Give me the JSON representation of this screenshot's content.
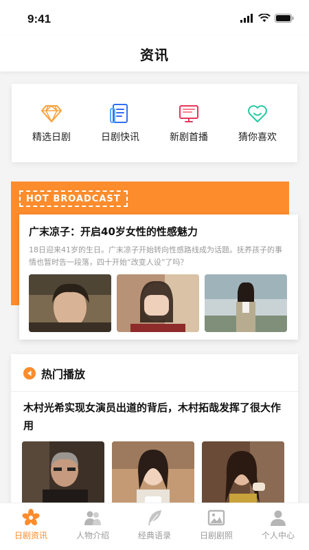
{
  "status_bar": {
    "time": "9:41"
  },
  "page": {
    "title": "资讯"
  },
  "categories": [
    {
      "label": "精选日剧",
      "icon": "diamond-icon",
      "color": "#f7a23b"
    },
    {
      "label": "日剧快讯",
      "icon": "news-doc-icon",
      "color": "#2f6ff0"
    },
    {
      "label": "新剧首播",
      "icon": "tv-icon",
      "color": "#e8345a"
    },
    {
      "label": "猜你喜欢",
      "icon": "heart-icon",
      "color": "#25c7a0"
    }
  ],
  "hot_broadcast": {
    "badge": "HOT BROADCAST",
    "title": "广末凉子：开启40岁女性的性感魅力",
    "description": "18日迎来41岁的生日。广末凉子开始转向性感路线成为话题。抚养孩子的事情也暂时告一段落，四十开始“改变人设”了吗？",
    "accent_color": "#fd8c2c"
  },
  "popular": {
    "title": "热门播放",
    "headline": "木村光希实现女演员出道的背后，木村拓哉发挥了很大作用"
  },
  "tabs": [
    {
      "label": "日剧资讯",
      "icon": "sakura-icon",
      "active": true
    },
    {
      "label": "人物介绍",
      "icon": "people-icon",
      "active": false
    },
    {
      "label": "经典语录",
      "icon": "feather-icon",
      "active": false
    },
    {
      "label": "日剧剧照",
      "icon": "photo-icon",
      "active": false
    },
    {
      "label": "个人中心",
      "icon": "user-icon",
      "active": false
    }
  ]
}
